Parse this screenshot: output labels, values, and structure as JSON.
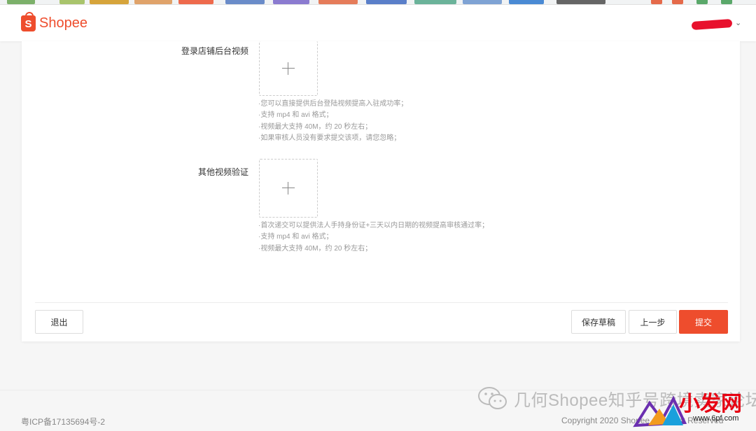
{
  "header": {
    "logo_text": "Shopee",
    "logo_glyph": "S"
  },
  "form": {
    "fields": [
      {
        "label": "登录店铺后台视频",
        "hints": [
          "·您可以直接提供后台登陆视频提高入驻成功率；",
          "·支持 mp4 和 avi 格式；",
          "·视频最大支持 40M，约 20 秒左右；",
          "·如果审核人员没有要求提交该项，请您忽略；"
        ]
      },
      {
        "label": "其他视频验证",
        "hints": [
          "·首次递交可以提供法人手持身份证+三天以内日期的视频提高审核通过率；",
          "·支持 mp4 和 avi 格式；",
          "·视频最大支持 40M，约 20 秒左右；"
        ]
      }
    ]
  },
  "actions": {
    "exit": "退出",
    "save_draft": "保存草稿",
    "previous": "上一步",
    "submit": "提交"
  },
  "footer": {
    "icp": "粤ICP备17135694号-2",
    "copyright": "Copyright 2020 Shopee. All Right Reserved"
  },
  "watermarks": {
    "wechat": "几何Shopee知乎号跨境卖家论坛",
    "brand": "小发网",
    "url": "www.6pf.com"
  },
  "colors": {
    "brand": "#ee4d2d",
    "watermark_red": "#e60012"
  }
}
